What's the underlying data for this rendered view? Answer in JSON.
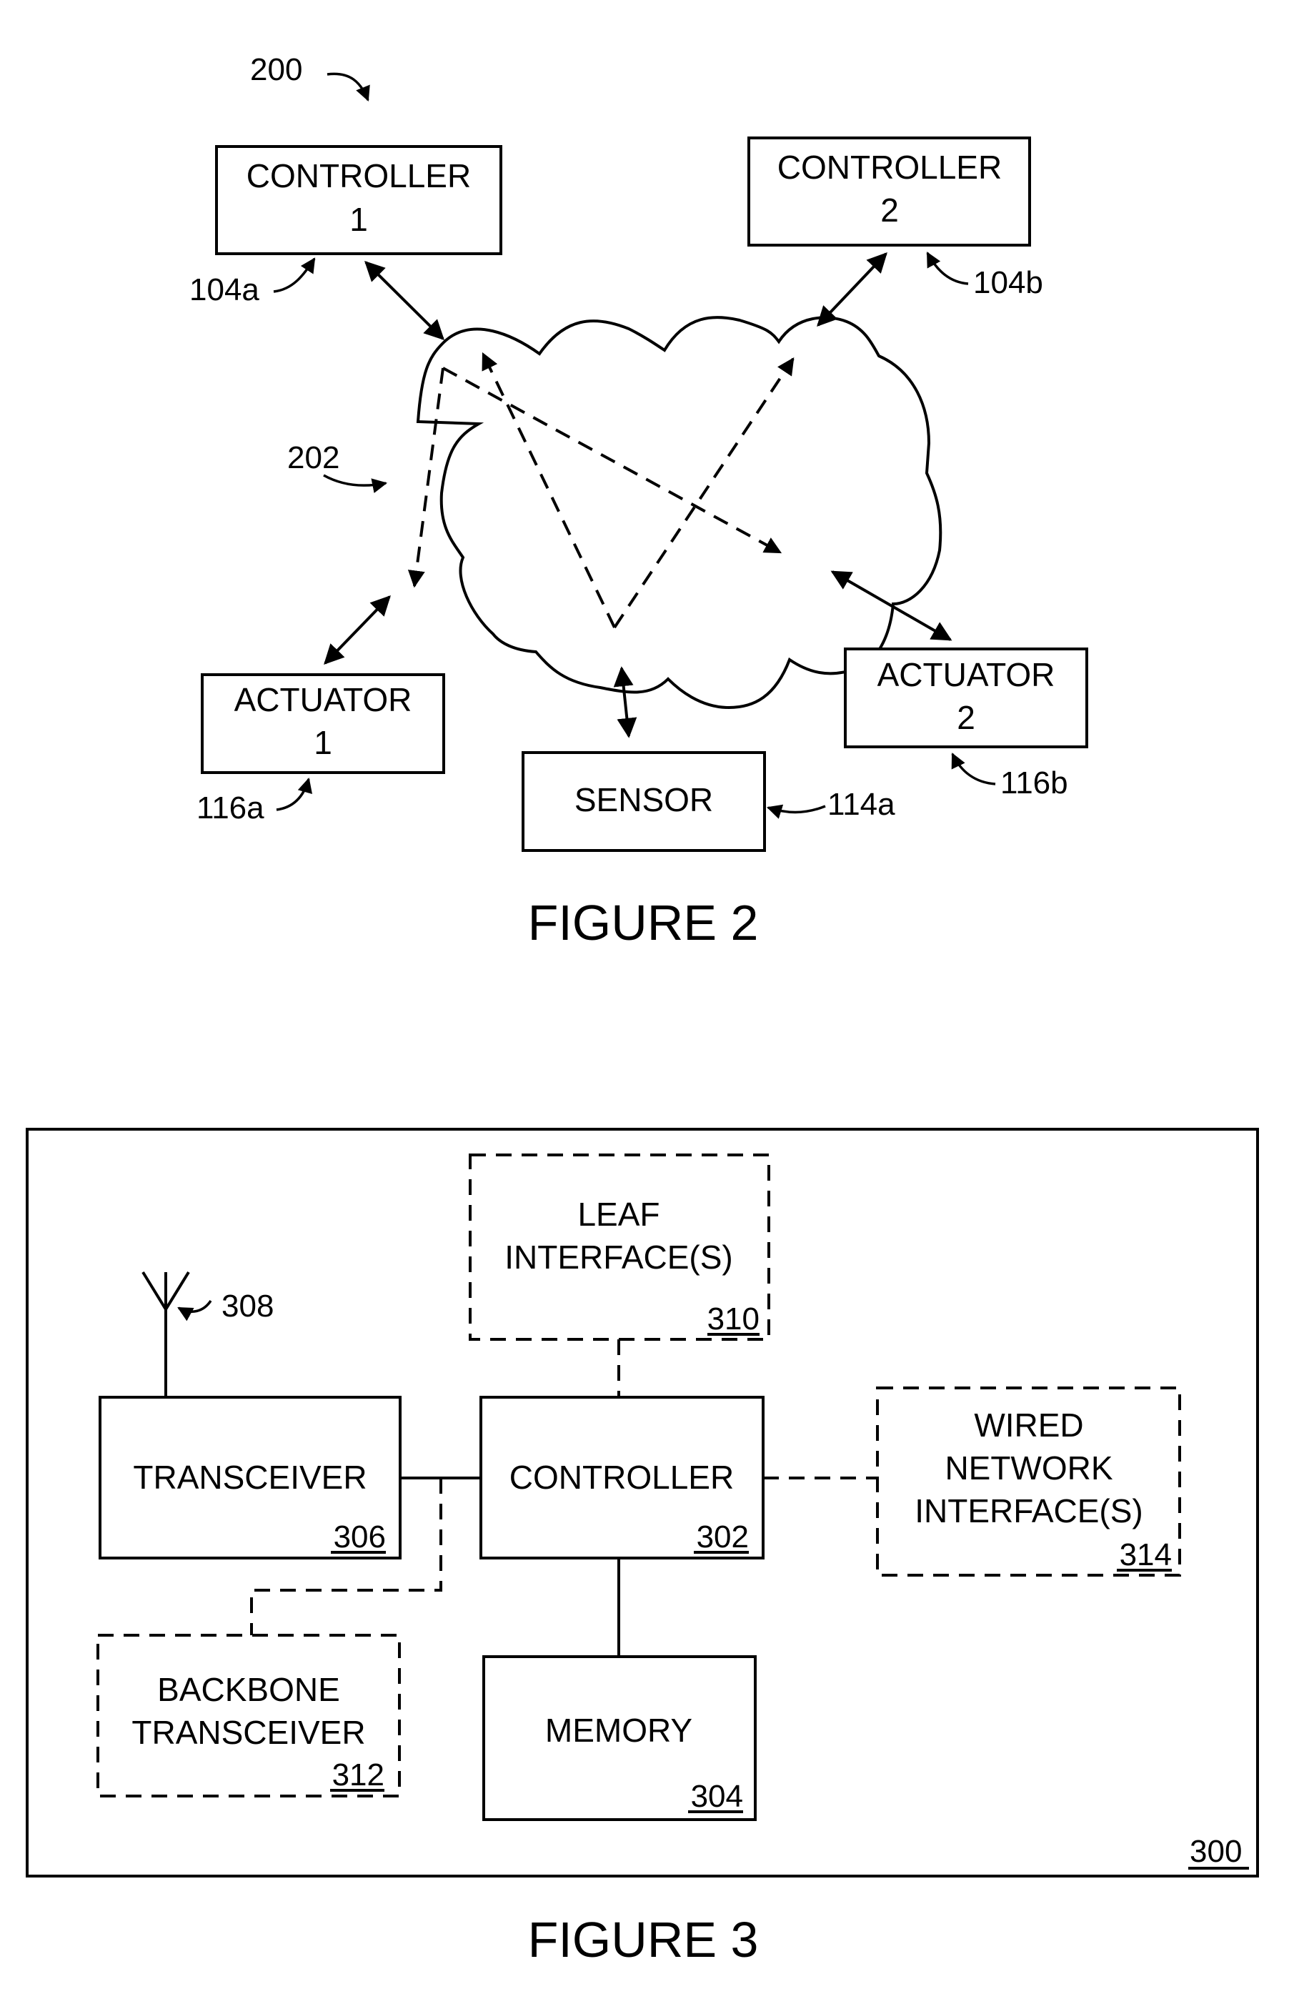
{
  "figure2": {
    "caption": "FIGURE 2",
    "ref": "200",
    "network": {
      "ref": "202"
    },
    "nodes": {
      "controller1": {
        "line1": "CONTROLLER",
        "line2": "1",
        "ref": "104a"
      },
      "controller2": {
        "line1": "CONTROLLER",
        "line2": "2",
        "ref": "104b"
      },
      "actuator1": {
        "line1": "ACTUATOR",
        "line2": "1",
        "ref": "116a"
      },
      "actuator2": {
        "line1": "ACTUATOR",
        "line2": "2",
        "ref": "116b"
      },
      "sensor": {
        "line1": "SENSOR",
        "ref": "114a"
      }
    }
  },
  "figure3": {
    "caption": "FIGURE 3",
    "ref": "300",
    "antenna": {
      "ref": "308"
    },
    "blocks": {
      "leaf": {
        "line1": "LEAF",
        "line2": "INTERFACE(S)",
        "ref": "310",
        "optional": true
      },
      "transceiver": {
        "line1": "TRANSCEIVER",
        "ref": "306",
        "optional": false
      },
      "controller": {
        "line1": "CONTROLLER",
        "ref": "302",
        "optional": false
      },
      "wired": {
        "line1": "WIRED",
        "line2": "NETWORK",
        "line3": "INTERFACE(S)",
        "ref": "314",
        "optional": true
      },
      "backbone": {
        "line1": "BACKBONE",
        "line2": "TRANSCEIVER",
        "ref": "312",
        "optional": true
      },
      "memory": {
        "line1": "MEMORY",
        "ref": "304",
        "optional": false
      }
    }
  }
}
